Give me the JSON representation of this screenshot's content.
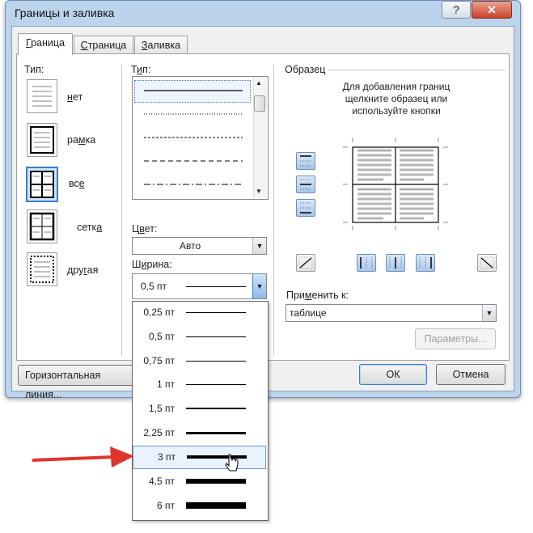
{
  "window": {
    "title": "Границы и заливка",
    "help_label": "?",
    "close_label": "✕"
  },
  "tabs": [
    {
      "pre": "",
      "u": "Г",
      "post": "раница"
    },
    {
      "pre": "",
      "u": "С",
      "post": "траница"
    },
    {
      "pre": "",
      "u": "З",
      "post": "аливка"
    }
  ],
  "setting": {
    "header": "Тип:",
    "items": [
      {
        "pre": "",
        "u": "н",
        "post": "ет",
        "icon": "none-border-icon"
      },
      {
        "pre": "ра",
        "u": "м",
        "post": "ка",
        "icon": "box-border-icon"
      },
      {
        "pre": "вс",
        "u": "е",
        "post": "",
        "icon": "all-borders-icon"
      },
      {
        "pre": "сетк",
        "u": "а",
        "post": "",
        "icon": "grid-border-icon"
      },
      {
        "pre": "дру",
        "u": "г",
        "post": "ая",
        "icon": "custom-border-icon"
      }
    ]
  },
  "style": {
    "header_pre": "Т",
    "header_u": "и",
    "header_post": "п:"
  },
  "color": {
    "label_pre": "Ц",
    "label_u": "в",
    "label_post": "ет:",
    "value": "Авто"
  },
  "width": {
    "label_pre": "Ш",
    "label_u": "и",
    "label_post": "рина:",
    "value": "0,5 пт",
    "options": [
      {
        "label": "0,25 пт",
        "thickness": 0.25
      },
      {
        "label": "0,5 пт",
        "thickness": 0.5
      },
      {
        "label": "0,75 пт",
        "thickness": 0.75
      },
      {
        "label": "1 пт",
        "thickness": 1
      },
      {
        "label": "1,5 пт",
        "thickness": 1.5
      },
      {
        "label": "2,25 пт",
        "thickness": 2.25
      },
      {
        "label": "3 пт",
        "thickness": 3
      },
      {
        "label": "4,5 пт",
        "thickness": 4.5
      },
      {
        "label": "6 пт",
        "thickness": 6
      }
    ],
    "highlighted": "3 пт"
  },
  "preview": {
    "header": "Образец",
    "hint": [
      "Для добавления границ",
      "щелкните образец или",
      "используйте кнопки"
    ]
  },
  "apply_to": {
    "label_pre": "При",
    "label_u": "м",
    "label_post": "енить к:",
    "value": "таблице"
  },
  "buttons": {
    "params": "Параметры...",
    "horizontal_line": "Горизонтальная линия...",
    "ok": "ОК",
    "cancel": "Отмена"
  },
  "colors": {
    "accent": "#3d7cc9",
    "arrow": "#e0352b",
    "title_bar": "#bcd3ec"
  }
}
